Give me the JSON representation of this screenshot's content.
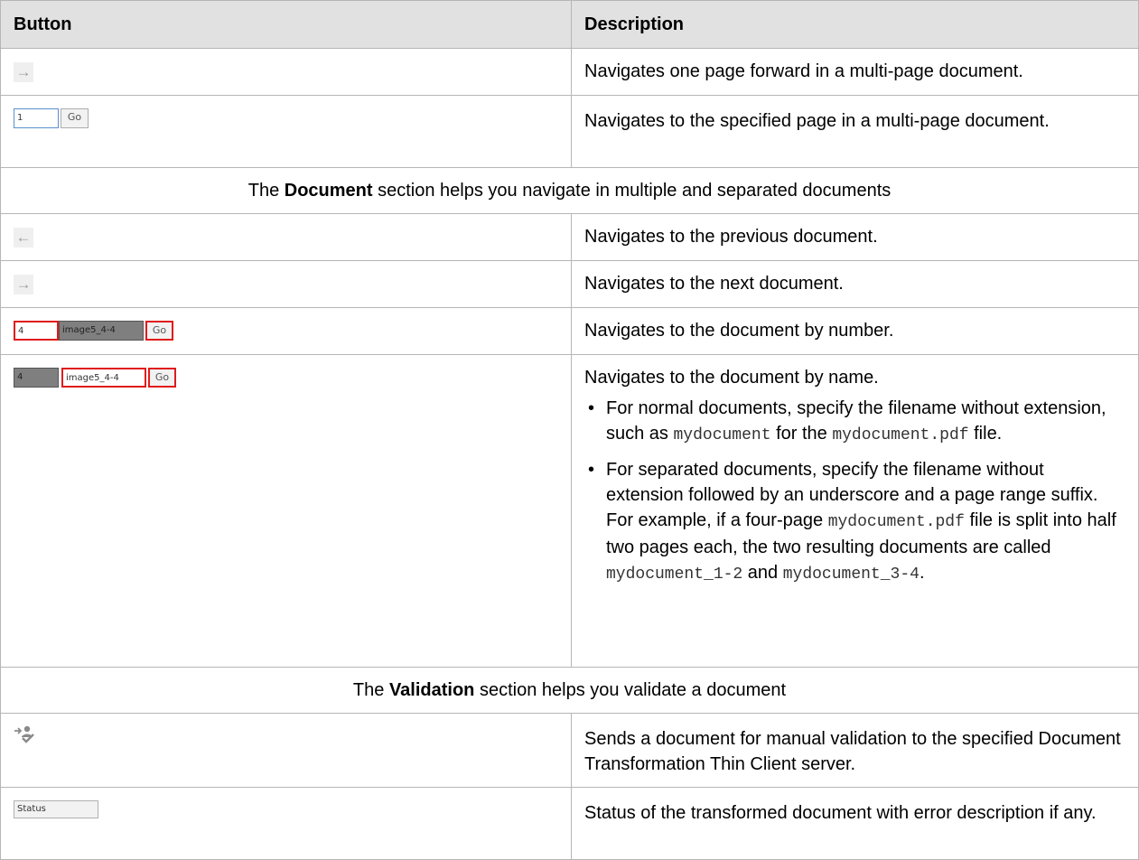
{
  "header": {
    "col_button": "Button",
    "col_description": "Description"
  },
  "rows": {
    "page_forward": {
      "icon": "arrow-right-icon",
      "glyph": "→",
      "description": "Navigates one page forward in a multi-page document."
    },
    "page_go": {
      "input_value": "1",
      "go_label": "Go",
      "description": "Navigates to the specified page in a multi-page document."
    },
    "doc_section": {
      "prefix": "The ",
      "bold": "Document",
      "suffix": " section helps you navigate in multiple and separated documents"
    },
    "doc_prev": {
      "icon": "arrow-left-icon",
      "glyph": "←",
      "description": "Navigates to the previous document."
    },
    "doc_next": {
      "icon": "arrow-right-icon",
      "glyph": "→",
      "description": "Navigates to the next document."
    },
    "doc_by_number": {
      "number_value": "4",
      "name_value": "image5_4-4",
      "go_label": "Go",
      "description": "Navigates to the document by number."
    },
    "doc_by_name": {
      "number_value": "4",
      "name_value": "image5_4-4",
      "go_label": "Go",
      "description": "Navigates to the document by name.",
      "bullet1": {
        "t1": "For normal documents, specify the filename without extension, such as ",
        "c1": "mydocument",
        "t2": " for the ",
        "c2": "mydocument.pdf",
        "t3": " file."
      },
      "bullet2": {
        "t1": "For separated documents, specify the filename without extension followed by an underscore and a page range suffix. For example, if a four-page ",
        "c1": "mydocument.pdf",
        "t2": " file is split into half two pages each, the two resulting documents are called ",
        "c2": "mydocument_1-2",
        "t3": " and ",
        "c3": "mydocument_3-4",
        "t4": "."
      }
    },
    "val_section": {
      "prefix": "The ",
      "bold": "Validation",
      "suffix": " section helps you validate a document"
    },
    "send_validation": {
      "icon": "send-for-validation-icon",
      "description": "Sends a document for manual validation to the specified Document Transformation Thin Client server."
    },
    "status": {
      "field_value": "Status",
      "description": "Status of the transformed document with error description if any."
    }
  },
  "colors": {
    "header_bg": "#e1e1e1",
    "border": "#b6b6b6",
    "highlight_red": "#e01b1b",
    "disabled_field": "#7f7f7f",
    "input_border_blue": "#5a8fd0"
  }
}
